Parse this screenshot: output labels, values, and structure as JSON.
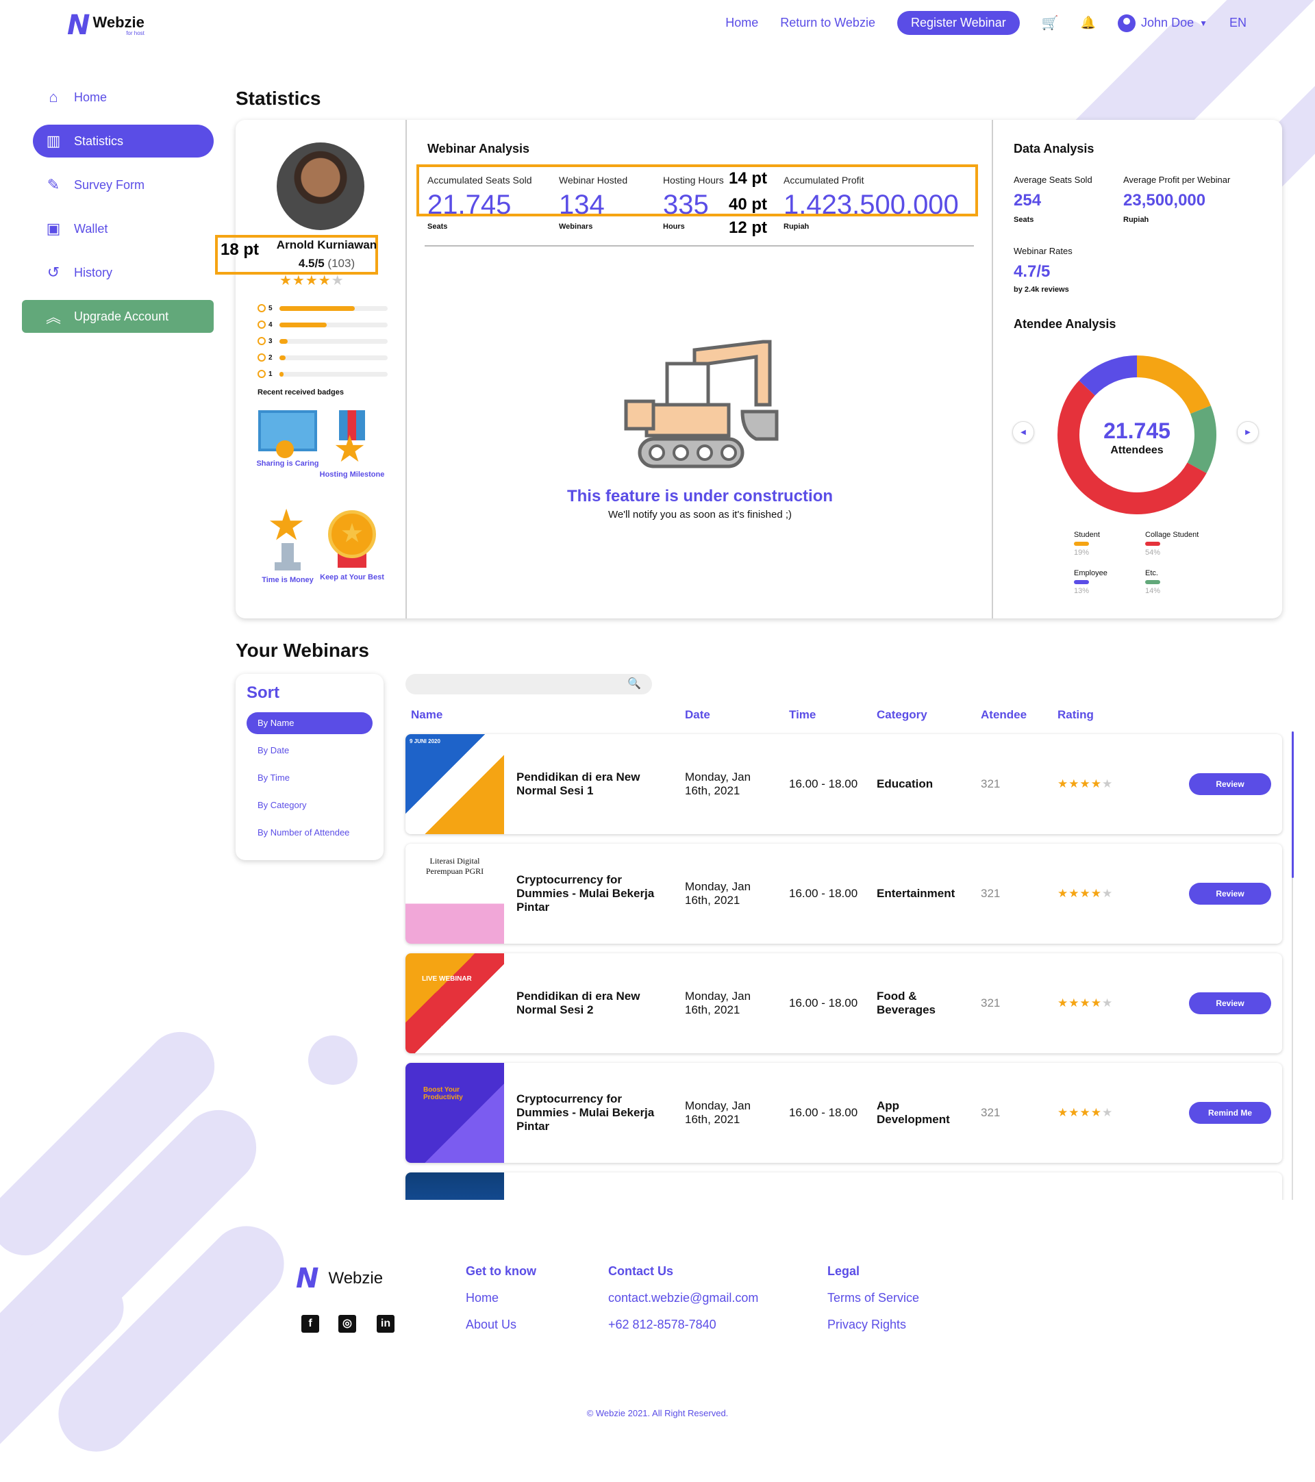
{
  "brand": {
    "name": "Webzie",
    "sub": "for host",
    "color": "#5a4de6"
  },
  "nav": {
    "home": "Home",
    "return": "Return to Webzie",
    "register": "Register Webinar",
    "user": "John Doe",
    "lang": "EN"
  },
  "sidebar": {
    "items": [
      {
        "label": "Home",
        "icon": "home-icon"
      },
      {
        "label": "Statistics",
        "icon": "chart-icon"
      },
      {
        "label": "Survey Form",
        "icon": "form-icon"
      },
      {
        "label": "Wallet",
        "icon": "wallet-icon"
      },
      {
        "label": "History",
        "icon": "history-icon"
      }
    ],
    "upgrade": "Upgrade Account"
  },
  "statistics": {
    "title": "Statistics",
    "profile": {
      "name": "Arnold Kurniawan",
      "rating": "4.5/5",
      "reviews": "(103)",
      "annotation_18": "18 pt",
      "annotation_14": "14 pt",
      "annotation_40": "40 pt",
      "annotation_12": "12 pt",
      "bars": [
        {
          "label": "5",
          "fill": 0.7
        },
        {
          "label": "4",
          "fill": 0.44
        },
        {
          "label": "3",
          "fill": 0.08
        },
        {
          "label": "2",
          "fill": 0.06
        },
        {
          "label": "1",
          "fill": 0.04
        }
      ],
      "badges_title": "Recent received badges",
      "badges": [
        "Sharing is Caring",
        "Hosting Milestone",
        "Time is Money",
        "Keep at Your Best"
      ]
    },
    "webinar_analysis": {
      "title": "Webinar Analysis",
      "metrics": [
        {
          "label": "Accumulated Seats Sold",
          "value": "21.745",
          "unit": "Seats"
        },
        {
          "label": "Webinar Hosted",
          "value": "134",
          "unit": "Webinars"
        },
        {
          "label": "Hosting Hours",
          "value": "335",
          "unit": "Hours"
        },
        {
          "label": "Accumulated Profit",
          "value": "1.423.500.000",
          "unit": "Rupiah"
        }
      ],
      "construction_title": "This feature is under construction",
      "construction_sub": "We'll notify you as soon as it's finished ;)"
    },
    "data_analysis": {
      "title": "Data Analysis",
      "avg_seats_label": "Average Seats Sold",
      "avg_seats": "254",
      "avg_seats_unit": "Seats",
      "avg_profit_label": "Average Profit per Webinar",
      "avg_profit": "23,500,000",
      "avg_profit_unit": "Rupiah",
      "rates_label": "Webinar Rates",
      "rates": "4.7/5",
      "rates_sub": "by 2.4k reviews",
      "attendee_title": "Atendee Analysis",
      "donut_value": "21.745",
      "donut_label": "Attendees",
      "legend": [
        {
          "name": "Student",
          "pct": "19%",
          "color": "#f5a413"
        },
        {
          "name": "Collage Student",
          "pct": "54%",
          "color": "#e5323b"
        },
        {
          "name": "Employee",
          "pct": "13%",
          "color": "#5a4de6"
        },
        {
          "name": "Etc.",
          "pct": "14%",
          "color": "#62a87a"
        }
      ]
    }
  },
  "webinars": {
    "title": "Your Webinars",
    "sort": {
      "title": "Sort",
      "options": [
        "By Name",
        "By Date",
        "By Time",
        "By Category",
        "By Number of Attendee"
      ]
    },
    "columns": [
      "Name",
      "Date",
      "Time",
      "Category",
      "Atendee",
      "Rating"
    ],
    "rows": [
      {
        "name": "Pendidikan di era New Normal Sesi 1",
        "date": "Monday, Jan 16th, 2021",
        "time": "16.00 - 18.00",
        "category": "Education",
        "attendee": "321",
        "action": "Review"
      },
      {
        "name": "Cryptocurrency for Dummies - Mulai Bekerja Pintar",
        "date": "Monday, Jan 16th, 2021",
        "time": "16.00 - 18.00",
        "category": "Entertainment",
        "attendee": "321",
        "action": "Review"
      },
      {
        "name": "Pendidikan di era New Normal Sesi 2",
        "date": "Monday, Jan 16th, 2021",
        "time": "16.00 - 18.00",
        "category": "Food & Beverages",
        "attendee": "321",
        "action": "Review"
      },
      {
        "name": "Cryptocurrency for Dummies - Mulai Bekerja Pintar",
        "date": "Monday, Jan 16th, 2021",
        "time": "16.00 - 18.00",
        "category": "App Development",
        "attendee": "321",
        "action": "Remind Me"
      }
    ],
    "thumb_texts": [
      "9 JUNI 2020",
      "Literasi Digital Perempuan PGRI",
      "LIVE WEBINAR",
      "Boost Your Productivity"
    ]
  },
  "footer": {
    "brand": "Webzie",
    "get_to_know": {
      "title": "Get to know",
      "links": [
        "Home",
        "About Us"
      ]
    },
    "contact": {
      "title": "Contact Us",
      "links": [
        "contact.webzie@gmail.com",
        "+62 812-8578-7840"
      ]
    },
    "legal": {
      "title": "Legal",
      "links": [
        "Terms of Service",
        "Privacy Rights"
      ]
    },
    "copyright": "© Webzie 2021. All Right Reserved."
  }
}
